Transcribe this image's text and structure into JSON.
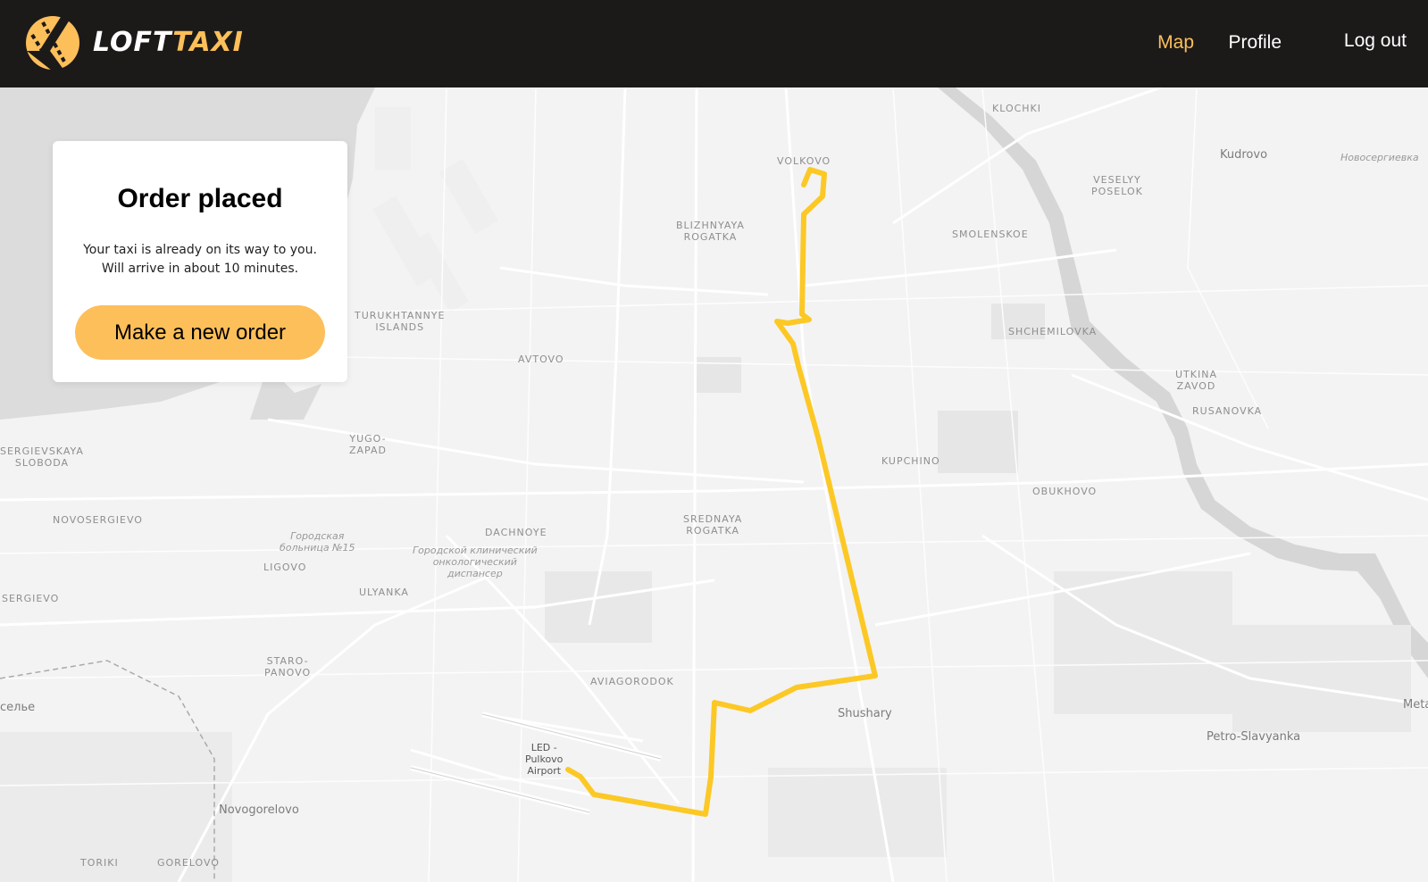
{
  "app": {
    "logo_part1": "LOFT",
    "logo_part2": "TAXI",
    "brand_color": "#fdbf5a"
  },
  "nav": {
    "items": [
      {
        "label": "Map",
        "active": true
      },
      {
        "label": "Profile",
        "active": false
      },
      {
        "label": "Log out",
        "active": false
      }
    ]
  },
  "order_card": {
    "title": "Order placed",
    "line1": "Your taxi is already on its way to you.",
    "line2": "Will arrive in about 10 minutes.",
    "button_label": "Make a new order"
  },
  "map": {
    "route_color": "#fcc825",
    "labels": {
      "klochki": "KLOCHKI",
      "kudrovo": "Kudrovo",
      "novosergievka": "Новосергиевка",
      "volkovo": "VOLKOVO",
      "veselyy1": "VESELYY",
      "veselyy2": "POSELOK",
      "blizh1": "BLIZHNYAYA",
      "blizh2": "ROGATKA",
      "smolenskoe": "SMOLENSKOE",
      "turukh1": "TURUKHTANNYE",
      "turukh2": "ISLANDS",
      "shchem": "SHCHEMILOVKA",
      "avtovo": "AVTOVO",
      "utkina1": "UTKINA",
      "utkina2": "ZAVOD",
      "rusanovka": "RUSANOVKA",
      "sergiev1": "SERGIEVSKAYA",
      "sergiev2": "SLOBODA",
      "yugo1": "YUGO-",
      "yugo2": "ZAPAD",
      "kupchino": "KUPCHINO",
      "obukhovo": "OBUKHOVO",
      "novosergievo": "NOVOSERGIEVO",
      "sredn1": "SREDNAYA",
      "sredn2": "ROGATKA",
      "dachnoe": "DACHNOYE",
      "gor1": "Городская",
      "gor2": "больница №15",
      "onko1": "Городской клинический",
      "onko2": "онкологический",
      "onko3": "диспансер",
      "ligovo": "LIGOVO",
      "sergievo": "SERGIEVO",
      "ulyanka": "ULYANKA",
      "staro1": "STARO-",
      "staro2": "PANOVO",
      "aviagorodok": "AVIAGORODOK",
      "selye": "селье",
      "shushary": "Shushary",
      "meta": "Meta",
      "airport1": "LED -",
      "airport2": "Pulkovo",
      "airport3": "Airport",
      "petro": "Petro-Slavyanka",
      "novogorelovo": "Novogorelovo",
      "toriki": "TORIKI",
      "gorelovo": "GORELOVO"
    }
  }
}
